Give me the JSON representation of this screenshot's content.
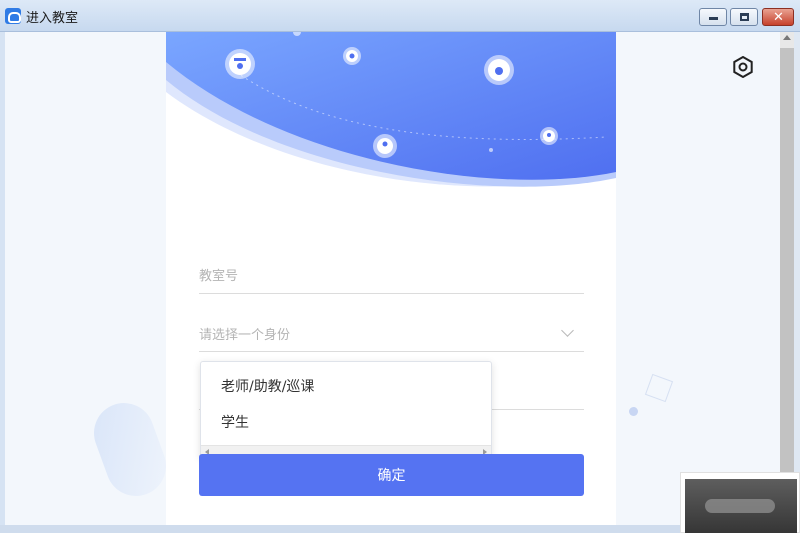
{
  "window": {
    "title": "进入教室",
    "icon": "cloud-app-icon",
    "buttons": [
      "minimize",
      "maximize",
      "close"
    ]
  },
  "form": {
    "classroom_placeholder": "教室号",
    "role_placeholder": "请选择一个身份",
    "name_placeholder": "",
    "confirm_label": "确定"
  },
  "dropdown": {
    "options": [
      "老师/助教/巡课",
      "学生"
    ]
  },
  "colors": {
    "primary": "#5573f2",
    "hero_gradient_start": "#7aa6ff",
    "hero_gradient_end": "#4f6ff0",
    "window_title_bg": "#dde9f7"
  },
  "icons": [
    "settings-gear-icon",
    "graduate-avatar-icon",
    "student-avatar-icon",
    "female-avatar-icon",
    "user-avatar-icon",
    "small-user-avatar-icon"
  ]
}
